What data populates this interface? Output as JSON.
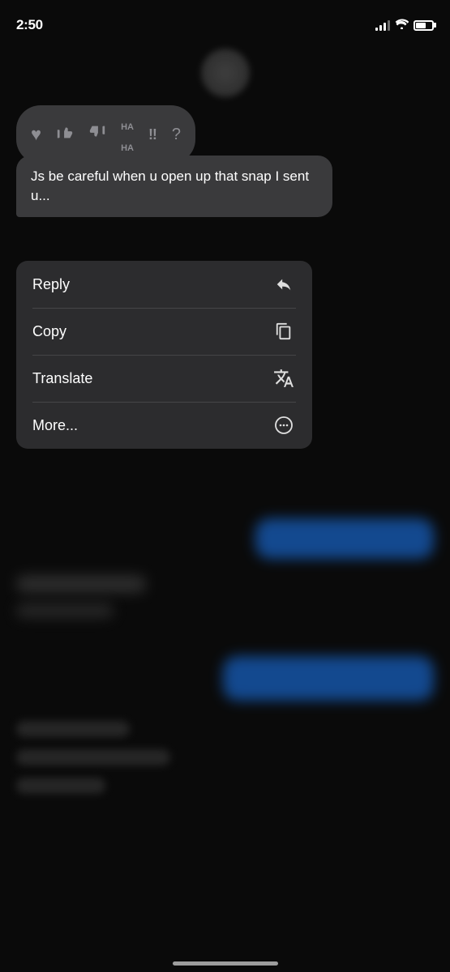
{
  "statusBar": {
    "time": "2:50",
    "battery_level": 65
  },
  "reactionBar": {
    "icons": [
      {
        "name": "heart",
        "symbol": "♥"
      },
      {
        "name": "thumbs-up",
        "symbol": "👍"
      },
      {
        "name": "thumbs-down",
        "symbol": "👎"
      },
      {
        "name": "haha",
        "text": "HA\nHA"
      },
      {
        "name": "exclamation",
        "symbol": "‼"
      },
      {
        "name": "question",
        "symbol": "?"
      }
    ]
  },
  "messageBubble": {
    "text": "Js be careful when u open up that snap I sent u..."
  },
  "contextMenu": {
    "items": [
      {
        "id": "reply",
        "label": "Reply"
      },
      {
        "id": "copy",
        "label": "Copy"
      },
      {
        "id": "translate",
        "label": "Translate"
      },
      {
        "id": "more",
        "label": "More..."
      }
    ]
  }
}
